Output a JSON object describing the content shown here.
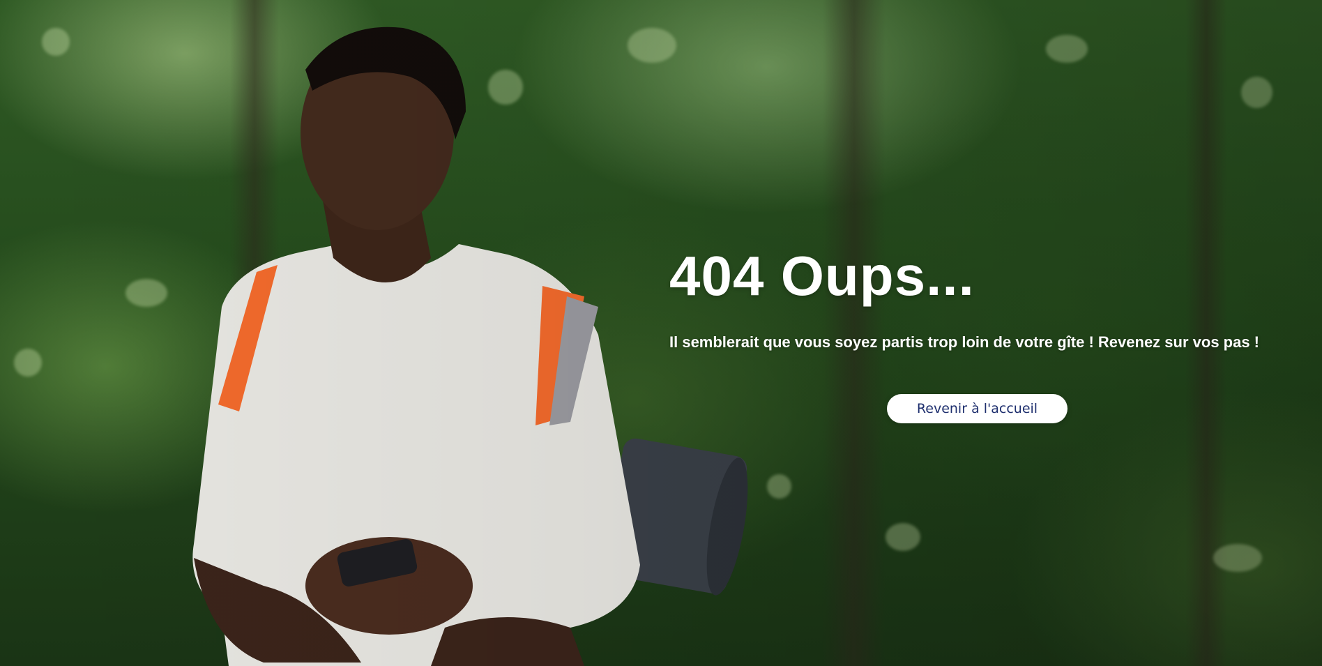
{
  "error": {
    "title": "404 Oups...",
    "message": "Il semblerait que vous soyez partis trop loin de votre gîte ! Revenez sur vos pas !",
    "home_button_label": "Revenir à l'accueil"
  },
  "background": {
    "description_icon": "forest-hiker-photo",
    "colors": {
      "foliage": "#2f5a24",
      "text": "#ffffff",
      "button_bg": "#ffffff",
      "button_text": "#1e2f6e"
    }
  }
}
